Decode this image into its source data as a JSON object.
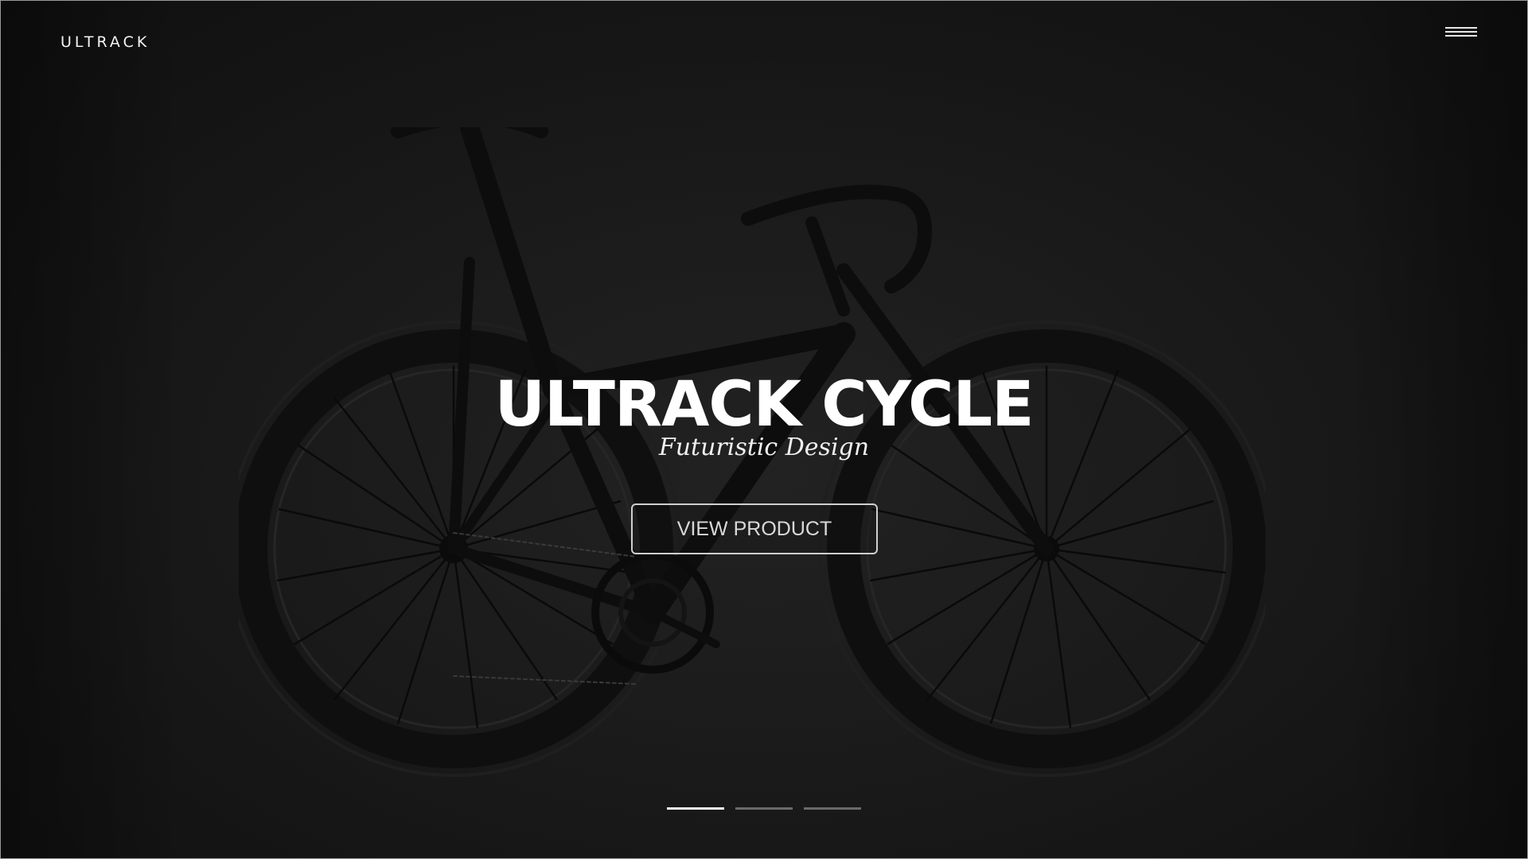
{
  "header": {
    "brand": "ULTRACK",
    "menu_icon": "hamburger-menu-icon"
  },
  "hero": {
    "title": "ULTRACK CYCLE",
    "subtitle": "Futuristic Design",
    "cta_label": "VIEW PRODUCT",
    "background_image": "road-bike-photo"
  },
  "slider": {
    "slide_count": 3,
    "active_index": 0
  },
  "colors": {
    "background": "#1b1b1b",
    "text": "#ffffff",
    "button_border": "#cfcfcf",
    "dot_active": "#f4f4f4",
    "dot_inactive": "#6a6a6a"
  }
}
